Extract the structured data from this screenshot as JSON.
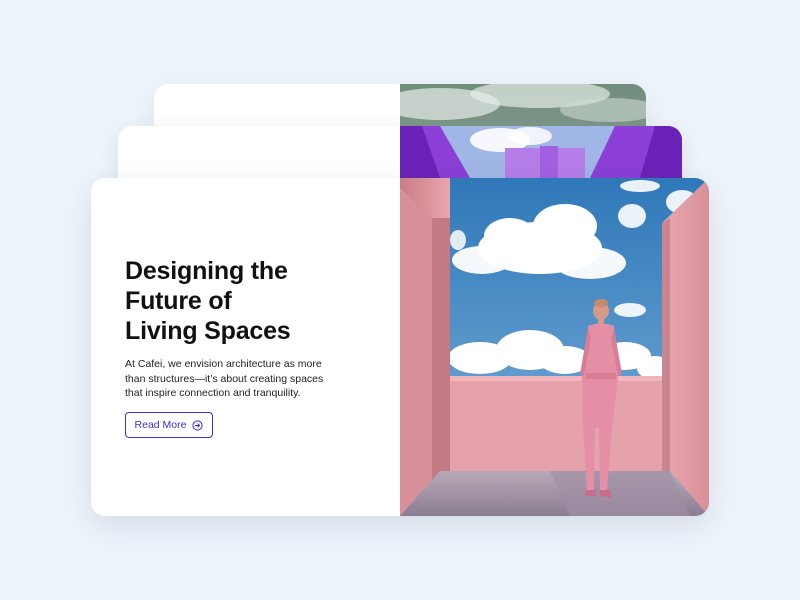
{
  "hero": {
    "title_lines": [
      "Designing the",
      "Future of",
      "Living Spaces"
    ],
    "description_lines": [
      "At Cafei, we envision architecture as more",
      "than structures—it’s about creating spaces",
      "that inspire connection and tranquility."
    ],
    "cta_label": "Read More",
    "cta_icon": "arrow-right-circle-icon"
  },
  "colors": {
    "page_background": "#eef4fb",
    "accent": "#3b2fd4",
    "heading": "#111111",
    "pink_wall": "#e9a3ab",
    "sky": "#3f8ac4",
    "purple_building": "#8b3fd6"
  },
  "images": {
    "back_card": "cloudy-sky-photo",
    "middle_card": "purple-architecture-photo",
    "front_card": "pink-architecture-woman-photo"
  }
}
